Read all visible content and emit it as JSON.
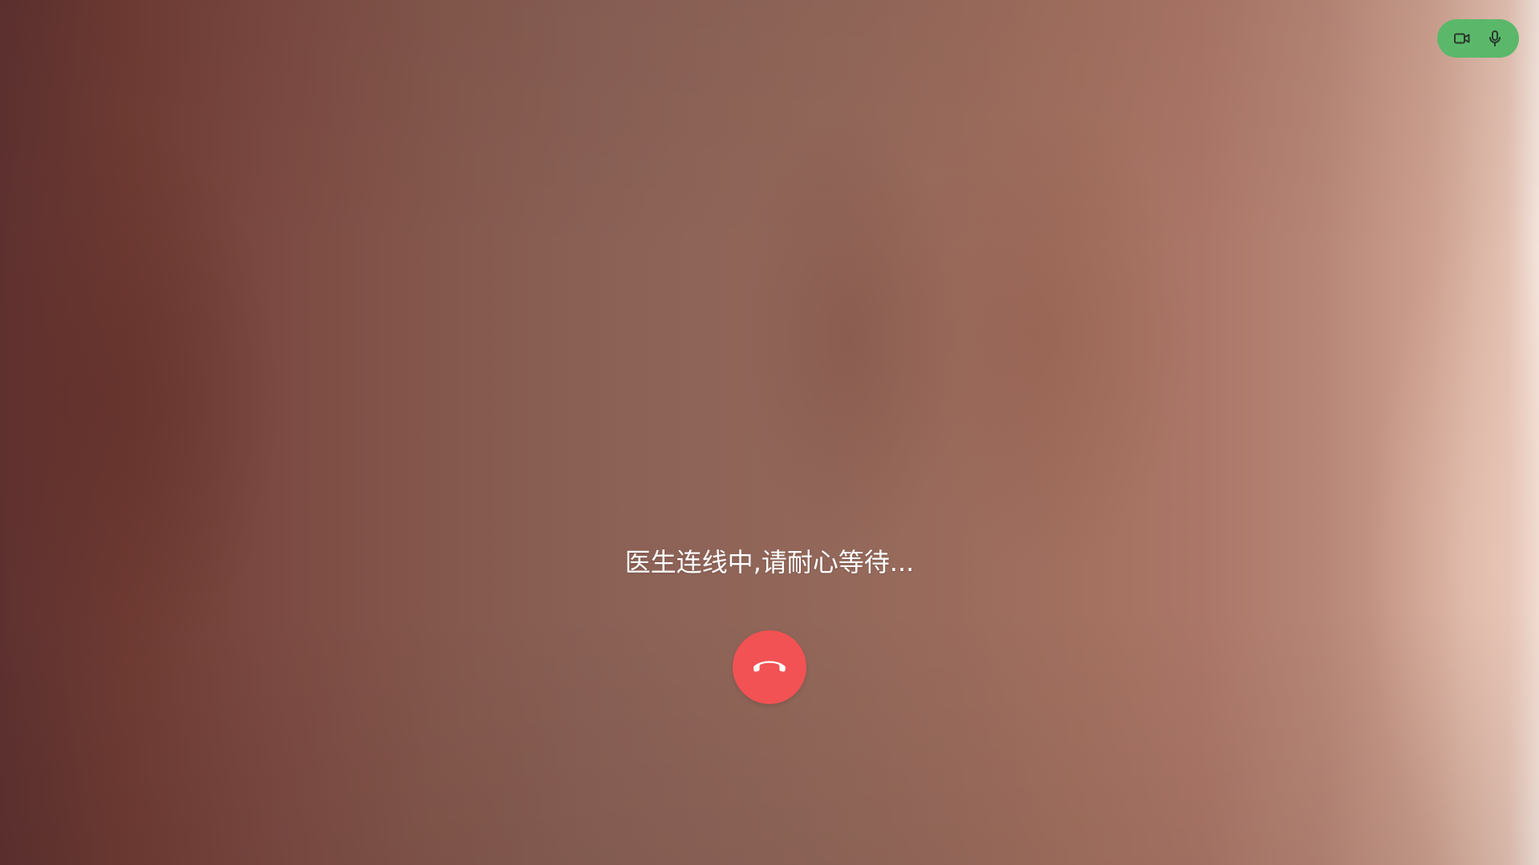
{
  "call": {
    "status_text": "医生连线中,请耐心等待..."
  },
  "controls": {
    "camera_icon": "video-camera-icon",
    "mic_icon": "microphone-icon",
    "hangup_icon": "phone-hangup-icon",
    "toggle_bg_color": "#5bb86a",
    "hangup_color": "#f25253"
  }
}
